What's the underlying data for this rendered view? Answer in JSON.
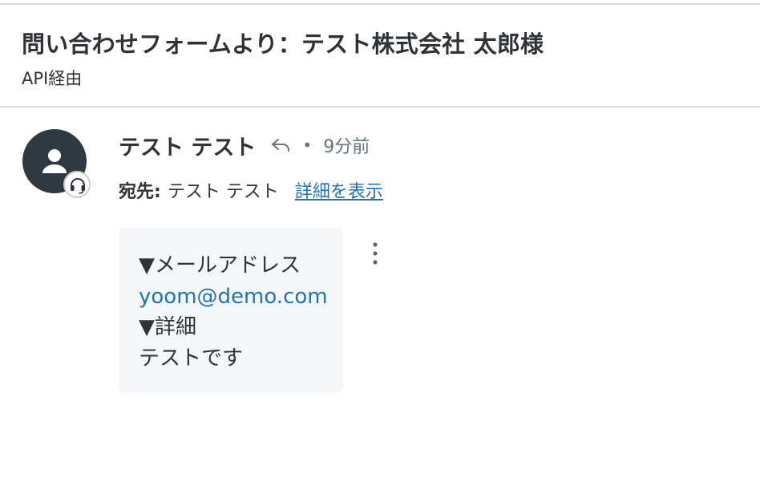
{
  "ticket": {
    "subject": "問い合わせフォームより：テスト株式会社 太郎様",
    "channel": "API経由"
  },
  "message": {
    "author": "テスト テスト",
    "separator": "•",
    "time_ago": "9分前",
    "to_label": "宛先:",
    "to_value": "テスト テスト",
    "details_link": "詳細を表示",
    "body": {
      "line1": "▼メールアドレス",
      "email": "yoom@demo.com",
      "line3": "▼詳細",
      "line4": "テストです"
    }
  },
  "icons": {
    "avatar": "person-icon",
    "agent_badge": "headset-icon",
    "reply": "reply-arrow-icon",
    "more": "vertical-ellipsis-icon"
  },
  "colors": {
    "link": "#1f73b7",
    "avatar_bg": "#2f3941",
    "bubble_bg": "#f5f6f7",
    "muted_text": "#68737d"
  }
}
